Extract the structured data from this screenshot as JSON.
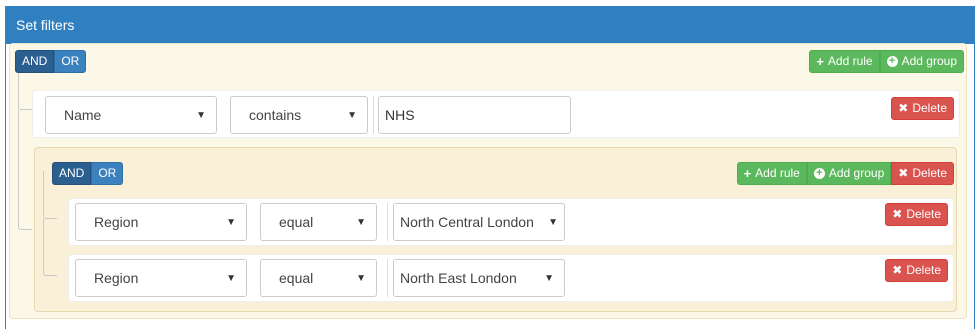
{
  "panel": {
    "title": "Set filters"
  },
  "labels": {
    "and": "AND",
    "or": "OR",
    "add_rule": "Add rule",
    "add_group": "Add group",
    "delete": "Delete"
  },
  "outer_group": {
    "condition": "AND",
    "rule": {
      "field": "Name",
      "operator": "contains",
      "value": "NHS"
    }
  },
  "inner_group": {
    "condition": "AND",
    "rules": [
      {
        "field": "Region",
        "operator": "equal",
        "value": "North Central London"
      },
      {
        "field": "Region",
        "operator": "equal",
        "value": "North East London"
      }
    ]
  },
  "colors": {
    "primary": "#2f7fc1",
    "success": "#5cb85c",
    "danger": "#d9534f",
    "group_bg": "#fcf8e8"
  },
  "icons": [
    "plus-icon",
    "plus-circle-icon",
    "times-icon",
    "caret-down-icon"
  ]
}
